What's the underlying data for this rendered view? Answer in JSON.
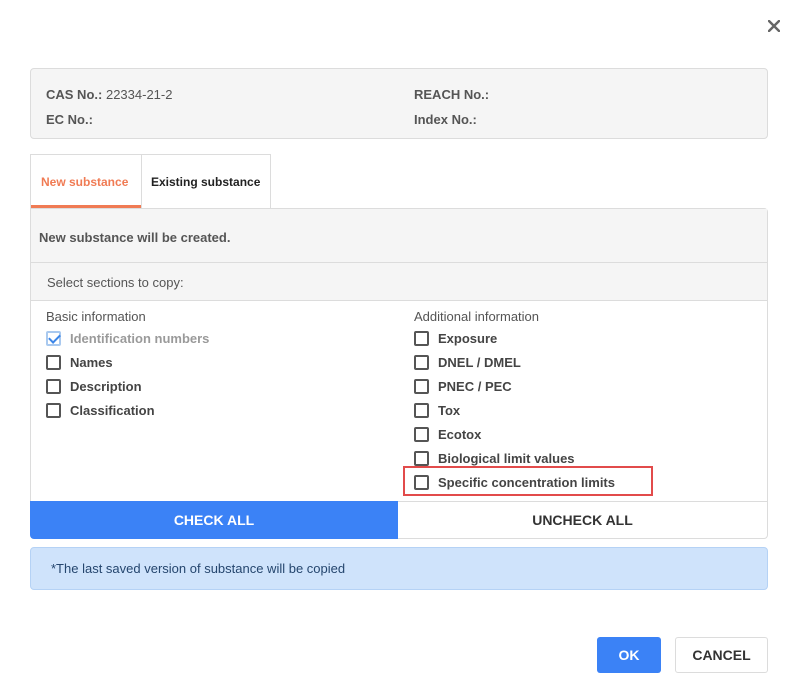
{
  "dialog": {
    "close_icon": "close-icon"
  },
  "info": {
    "cas_label": "CAS No.:",
    "cas_value": "22334-21-2",
    "ec_label": "EC No.:",
    "ec_value": "",
    "reach_label": "REACH No.:",
    "reach_value": "",
    "index_label": "Index No.:",
    "index_value": ""
  },
  "tabs": [
    {
      "label": "New substance",
      "active": true
    },
    {
      "label": "Existing substance",
      "active": false
    }
  ],
  "panel": {
    "message": "New substance will be created.",
    "select_label": "Select sections to copy:"
  },
  "basic": {
    "title": "Basic information",
    "items": [
      {
        "label": "Identification numbers",
        "checked": true,
        "disabled": true
      },
      {
        "label": "Names",
        "checked": false
      },
      {
        "label": "Description",
        "checked": false
      },
      {
        "label": "Classification",
        "checked": false
      }
    ]
  },
  "additional": {
    "title": "Additional information",
    "items": [
      {
        "label": "Exposure",
        "checked": false
      },
      {
        "label": "DNEL / DMEL",
        "checked": false
      },
      {
        "label": "PNEC / PEC",
        "checked": false
      },
      {
        "label": "Tox",
        "checked": false
      },
      {
        "label": "Ecotox",
        "checked": false
      },
      {
        "label": "Biological limit values",
        "checked": false
      },
      {
        "label": "Specific concentration limits",
        "checked": false,
        "highlighted": true
      }
    ]
  },
  "actions": {
    "check_all": "CHECK ALL",
    "uncheck_all": "UNCHECK ALL",
    "ok": "OK",
    "cancel": "CANCEL"
  },
  "notice": "*The last saved version of substance will be copied",
  "colors": {
    "accent": "#3b82f6",
    "tab_active": "#f07b54",
    "highlight": "#e24b4b",
    "notice_bg": "#cfe3fb"
  }
}
